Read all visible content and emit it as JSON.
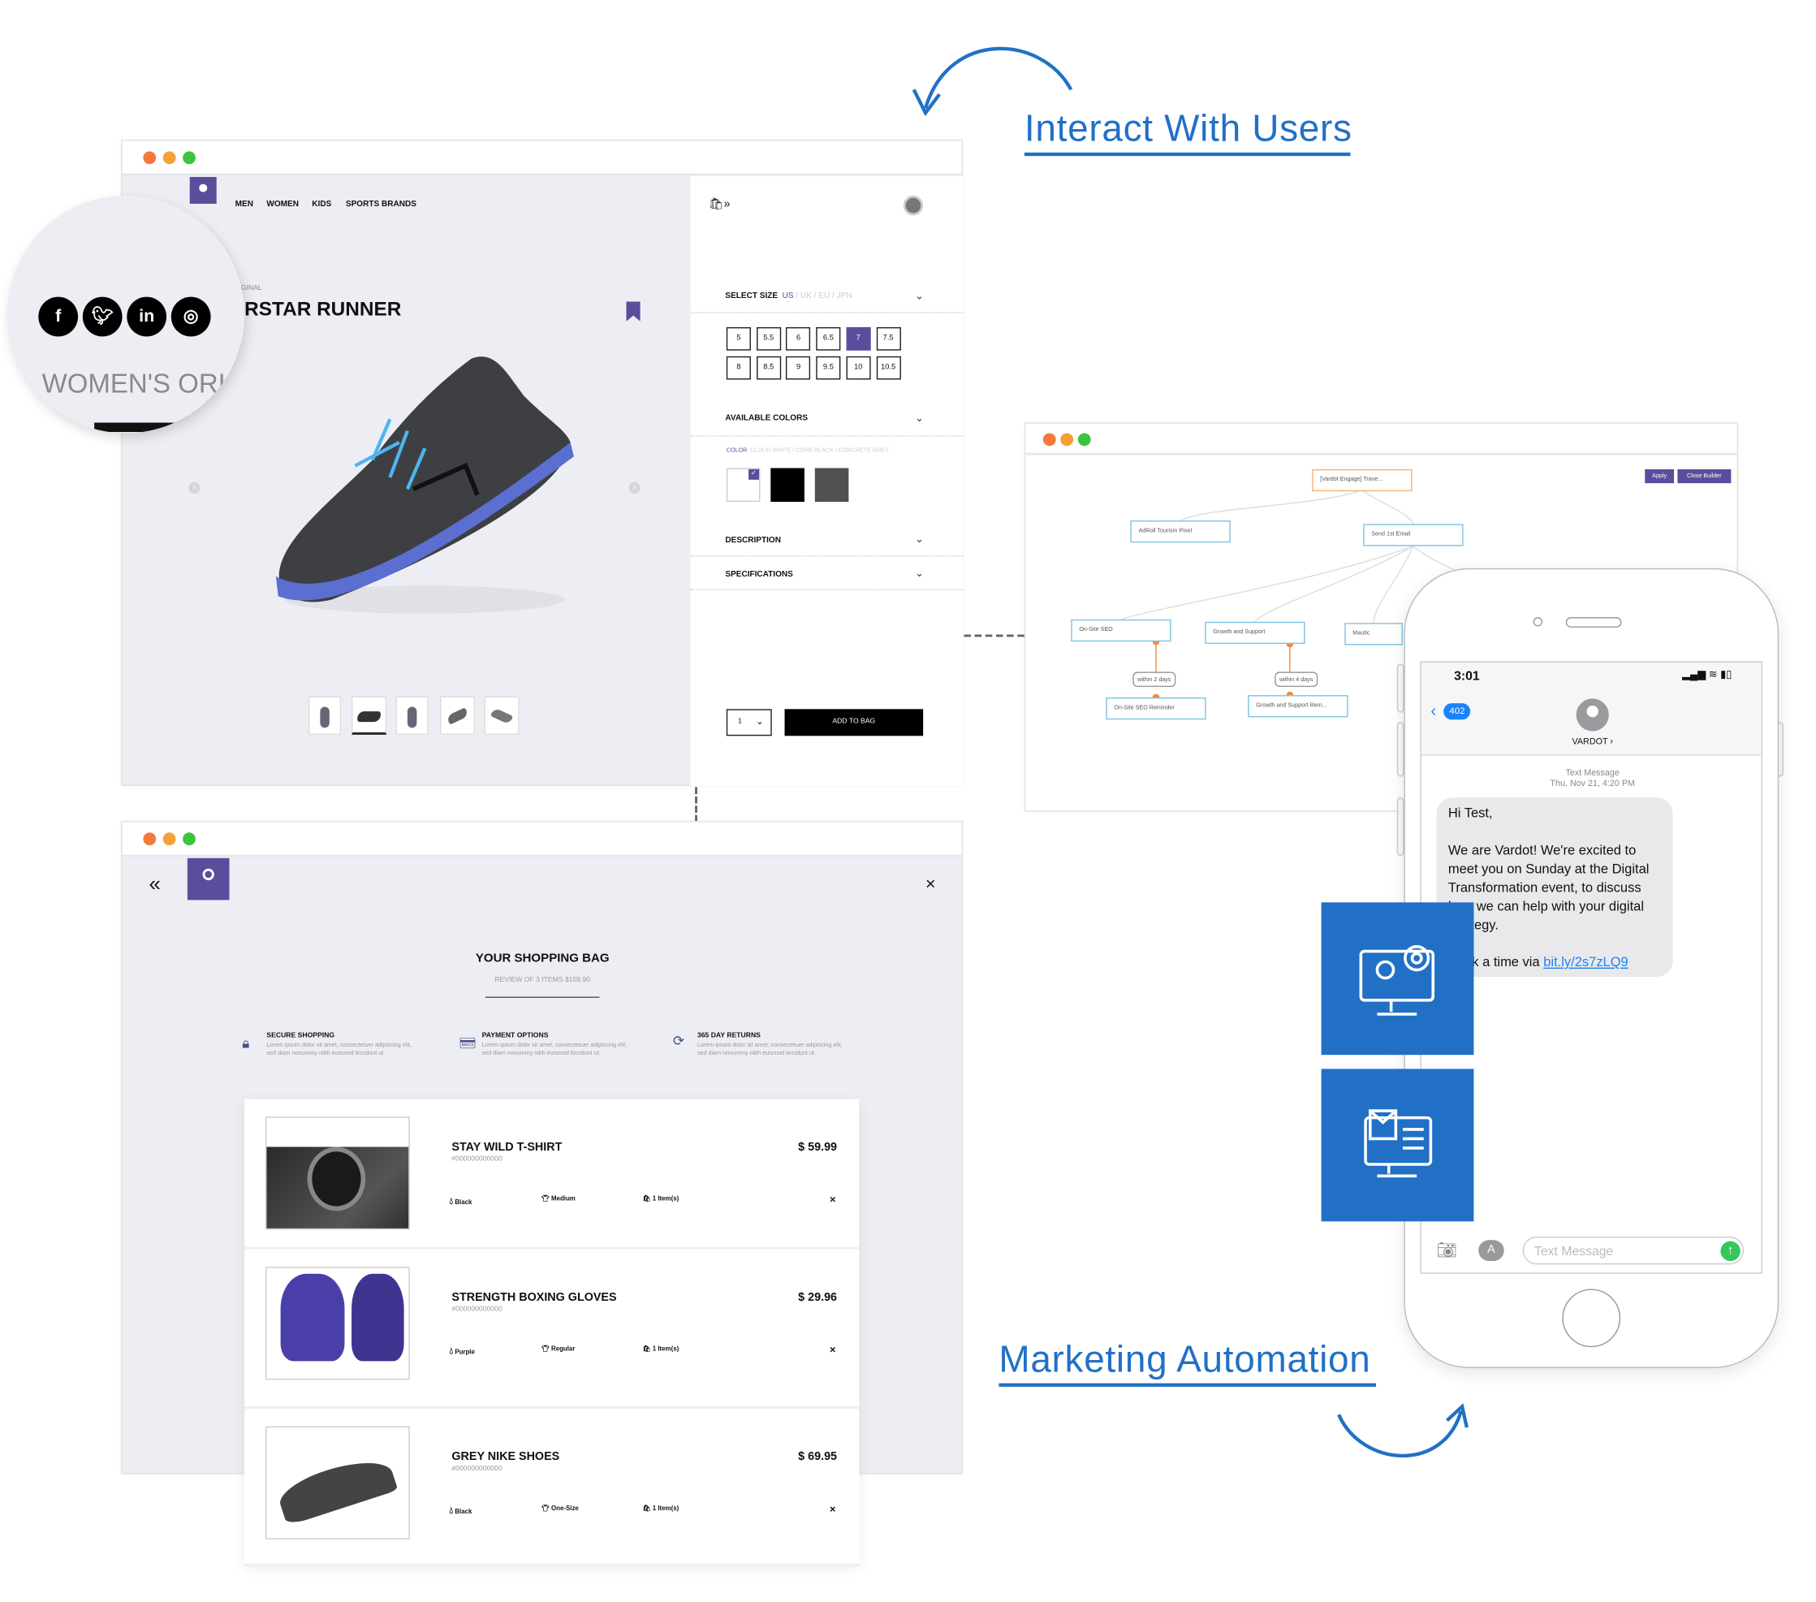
{
  "headings": {
    "interact": "Interact With Users",
    "marketing": "Marketing Automation"
  },
  "colors": {
    "accent_blue": "#2170c6",
    "brand_purple": "#5a4e9c",
    "dot_red": "#f5793b",
    "dot_orange": "#f5a03b",
    "dot_green": "#3cc43c"
  },
  "social": {
    "icons": [
      "facebook-icon",
      "twitter-icon",
      "linkedin-icon",
      "instagram-icon"
    ],
    "labels": [
      "f",
      "t",
      "in",
      "◎"
    ],
    "banner_text": "WOMEN'S ORI"
  },
  "product": {
    "nav": [
      "MEN",
      "WOMEN",
      "KIDS",
      "SPORTS BRANDS"
    ],
    "eyebrow": "GINAL",
    "title": "RSTAR RUNNER",
    "select_size": "SELECT SIZE",
    "size_systems": {
      "active": "US",
      "others": " / UK / EU / JPN"
    },
    "sizes": [
      "5",
      "5.5",
      "6",
      "6.5",
      "7",
      "7.5",
      "8",
      "8.5",
      "9",
      "9.5",
      "10",
      "10.5"
    ],
    "selected_size": "7",
    "available_colors": "AVAILABLE COLORS",
    "color_label": "COLOR",
    "color_names": "CLOUD WHITE / CORE BLACK / CONCRETE GREY",
    "swatches": [
      "#ffffff",
      "#000000",
      "#505050"
    ],
    "description": "DESCRIPTION",
    "specifications": "SPECIFICATIONS",
    "quantity": "1",
    "add_to_bag": "ADD TO BAG"
  },
  "bag": {
    "title": "YOUR SHOPPING BAG",
    "subtitle": "REVIEW OF 3 ITEMS $159.90",
    "features": [
      {
        "title": "SECURE SHOPPING",
        "text": "Lorem ipsum dolor sit amet, consectetuer adipiscing elit, sed diam nonummy nibh euismod tincidunt ut."
      },
      {
        "title": "PAYMENT OPTIONS",
        "text": "Lorem ipsum dolor sit amet, consectetuer adipiscing elit, sed diam nonummy nibh euismod tincidunt ut."
      },
      {
        "title": "365 DAY RETURNS",
        "text": "Lorem ipsum dolor sit amet, consectetuer adipiscing elit, sed diam nonummy nibh euismod tincidunt ut."
      }
    ],
    "items": [
      {
        "name": "STAY WILD T-SHIRT",
        "sku": "#000000000000",
        "price": "$ 59.99",
        "color": "Black",
        "size": "Medium",
        "qty": "1 Item(s)"
      },
      {
        "name": "STRENGTH BOXING GLOVES",
        "sku": "#000000000000",
        "price": "$ 29.96",
        "color": "Purple",
        "size": "Regular",
        "qty": "1 Item(s)"
      },
      {
        "name": "GREY NIKE SHOES",
        "sku": "#000000000000",
        "price": "$ 69.95",
        "color": "Black",
        "size": "One-Size",
        "qty": "1 Item(s)"
      }
    ],
    "remove": "×",
    "back": "«",
    "close": "×"
  },
  "flow": {
    "apply": "Apply",
    "close_builder": "Close Builder",
    "nodes": [
      "[Vardot Engage] Trave...",
      "AdRoll Tourism Pixel",
      "Send 1st Email",
      "On-Site SEO",
      "Growth and Support",
      "Mautic",
      "On-Site SEO Reminder",
      "Growth and Support Rem..."
    ],
    "conditions": [
      "within 2 days",
      "within 4 days"
    ]
  },
  "phone": {
    "time": "3:01",
    "back_count": "402",
    "contact": "VARDOT ›",
    "msg_type": "Text Message",
    "msg_date": "Thu, Nov 21, 4:20 PM",
    "greeting": "Hi Test,",
    "body": "We are Vardot! We're excited to meet you on Sunday at the Digital Transformation event, to discuss how we can help with your digital strategy.",
    "cta": "Book a time via ",
    "link": "bit.ly/2s7zLQ9",
    "input_placeholder": "Text Message"
  }
}
